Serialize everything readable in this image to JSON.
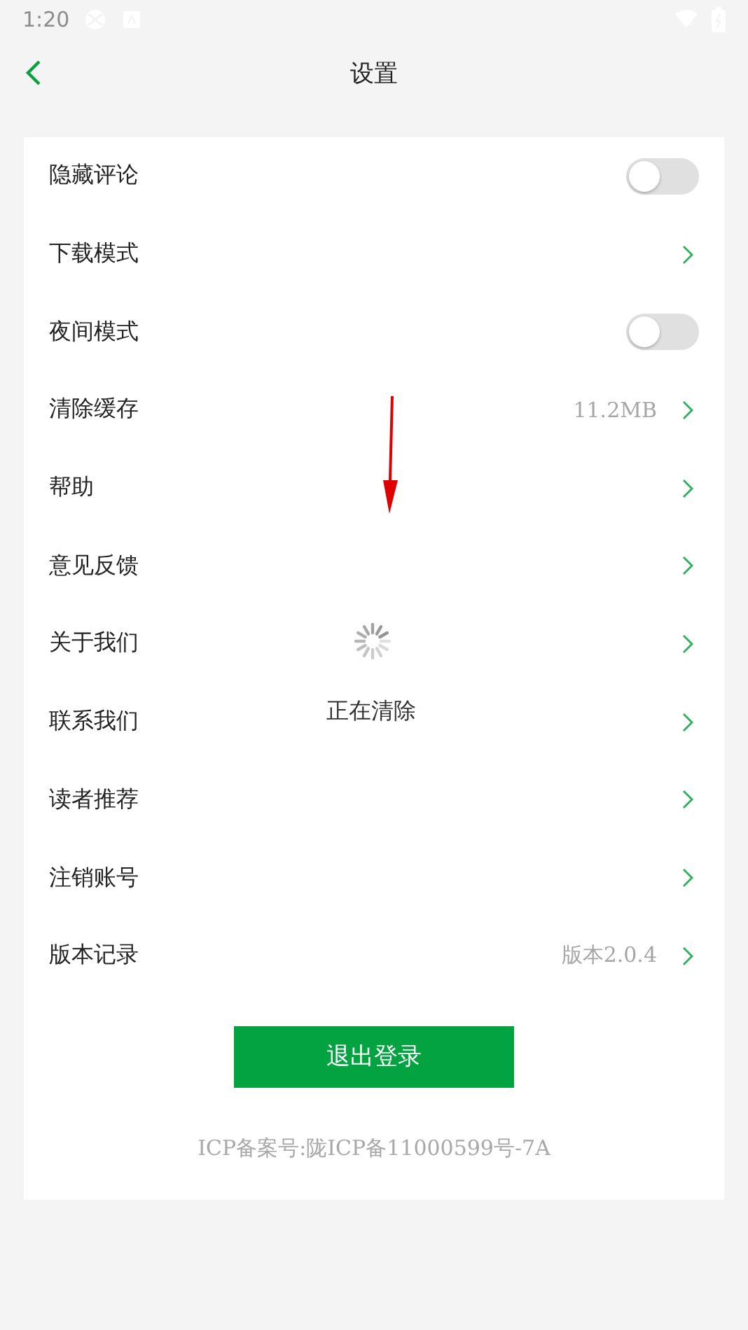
{
  "status_bar": {
    "time": "1:20"
  },
  "nav_bar": {
    "title": "设置"
  },
  "settings": [
    {
      "kind": "toggle",
      "label": "隐藏评论",
      "on": false
    },
    {
      "kind": "link",
      "label": "下载模式"
    },
    {
      "kind": "toggle",
      "label": "夜间模式",
      "on": false
    },
    {
      "kind": "link",
      "label": "清除缓存",
      "value": "11.2MB"
    },
    {
      "kind": "link",
      "label": "帮助"
    },
    {
      "kind": "link",
      "label": "意见反馈"
    },
    {
      "kind": "link",
      "label": "关于我们"
    },
    {
      "kind": "link",
      "label": "联系我们"
    },
    {
      "kind": "link",
      "label": "读者推荐"
    },
    {
      "kind": "link",
      "label": "注销账号"
    },
    {
      "kind": "link",
      "label": "版本记录",
      "value": "版本2.0.4"
    }
  ],
  "logout_button": "退出登录",
  "icp": "ICP备案号:陇ICP备11000599号-7A",
  "loading": {
    "text": "正在清除"
  }
}
